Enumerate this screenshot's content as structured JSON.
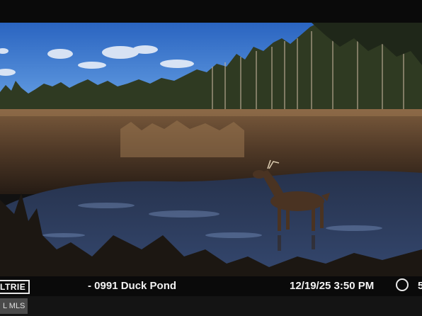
{
  "trail_camera": {
    "brand": "LTRIE",
    "camera_name": "- 0991 Duck Pond",
    "timestamp": "12/19/25 3:50 PM",
    "moon_phase_icon": "full-moon-icon",
    "trailing_mark": "5"
  },
  "watermark": {
    "text": "MLS",
    "prefix": "L"
  },
  "scene": {
    "subject": "deer-standing-in-marsh",
    "sky_color": "#2f6fc9",
    "water_color": "#2d3f63",
    "marsh_color": "#6a4a30"
  }
}
